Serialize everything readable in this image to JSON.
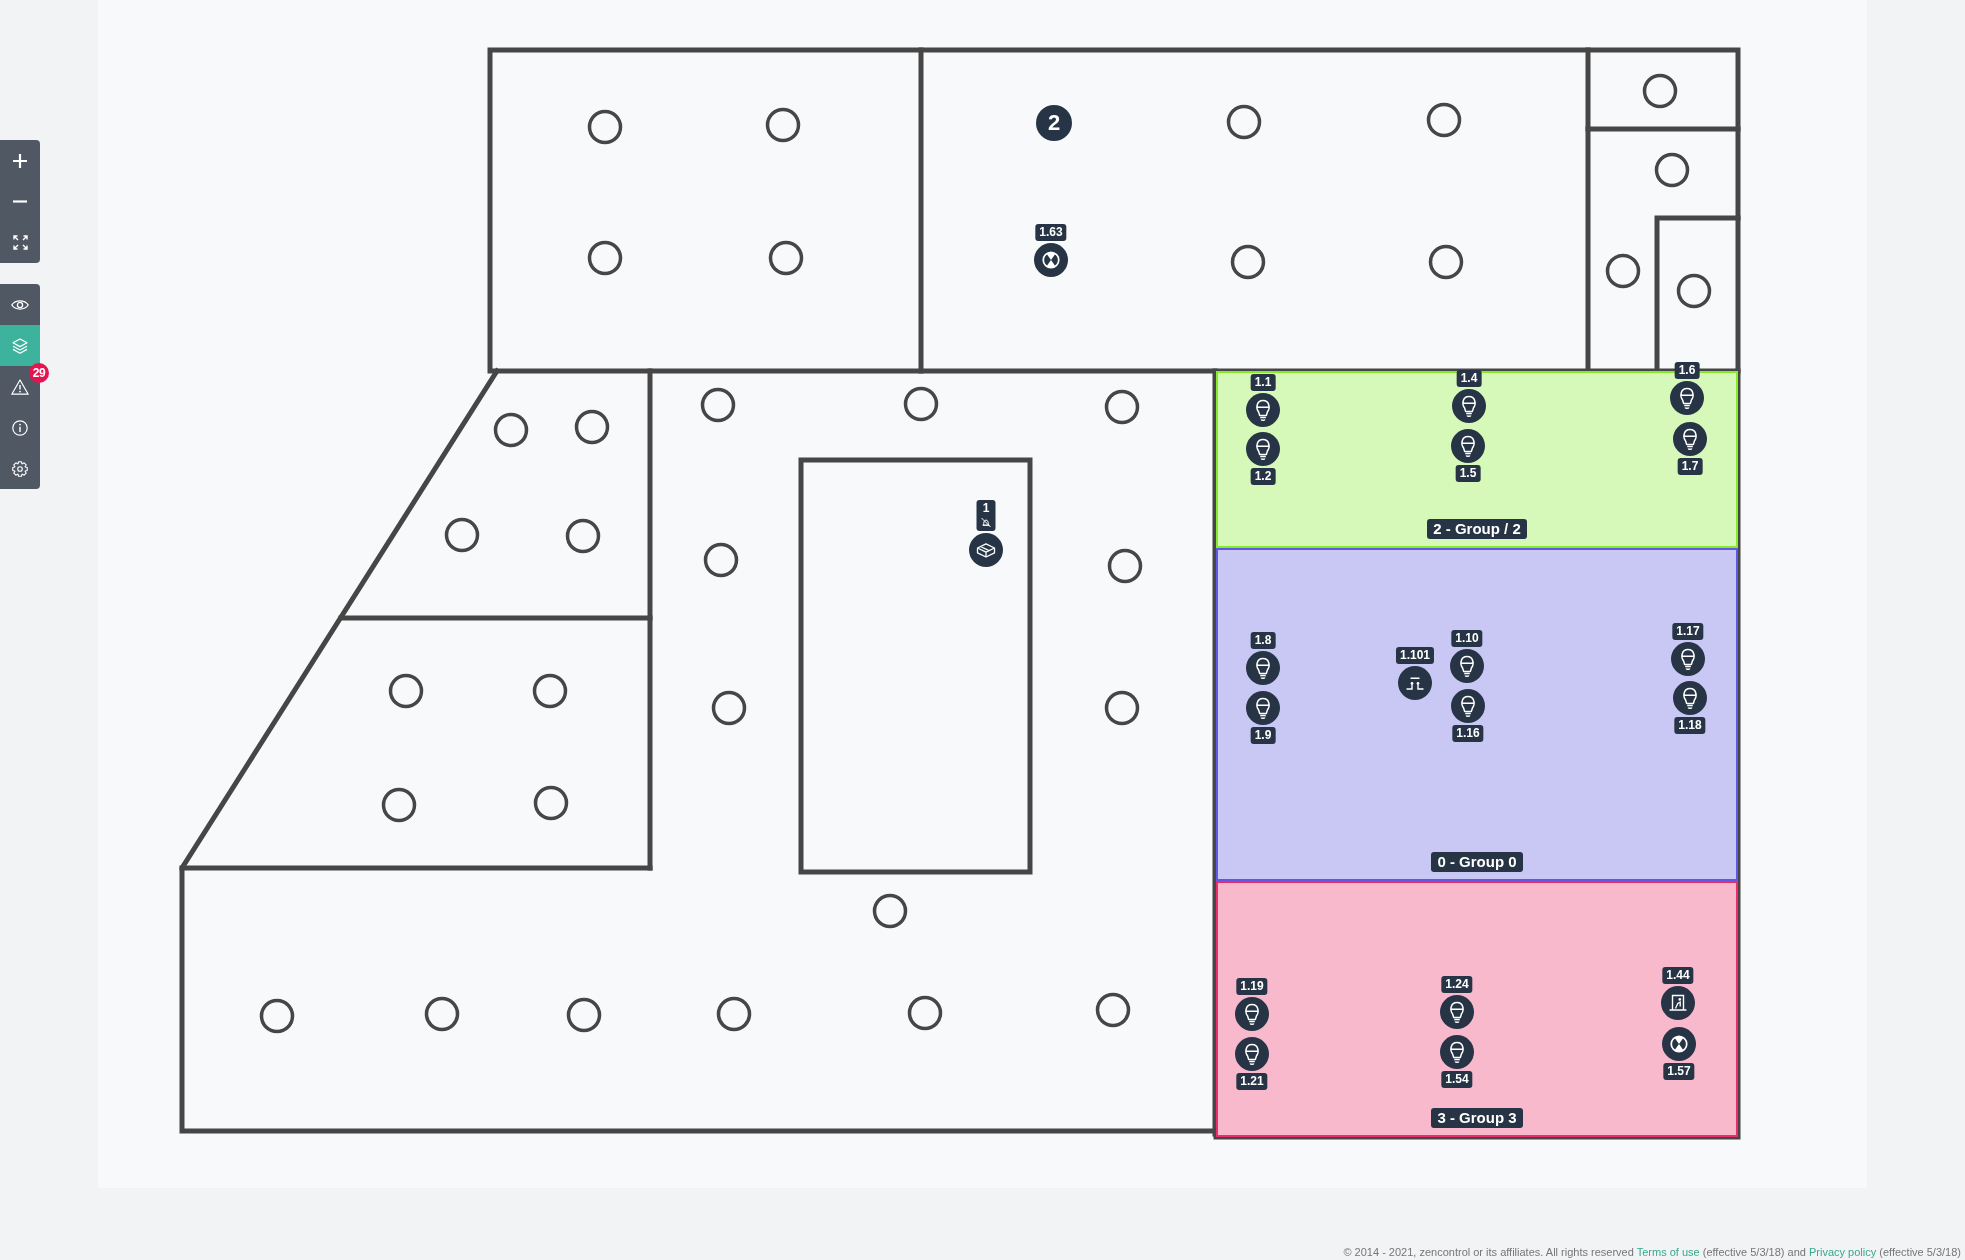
{
  "toolbar": {
    "zoom_buttons": [
      {
        "kind": "zoom-in"
      },
      {
        "kind": "zoom-out"
      },
      {
        "kind": "fit"
      }
    ],
    "view_buttons": [
      {
        "kind": "visibility",
        "selected": false
      },
      {
        "kind": "layers",
        "selected": true
      },
      {
        "kind": "warnings",
        "selected": false,
        "badge": "29"
      },
      {
        "kind": "info",
        "selected": false
      },
      {
        "kind": "settings",
        "selected": false
      }
    ]
  },
  "floor_plan": {
    "area_marker": {
      "label": "2"
    },
    "devices": [
      {
        "kind": "emergency",
        "label": "1.63"
      },
      {
        "kind": "controller",
        "label": "1",
        "offline": true
      }
    ],
    "groups": [
      {
        "label": "2 - Group / 2",
        "color": "#d6f8b8",
        "devices": [
          {
            "kind": "lamp",
            "label": "1.1"
          },
          {
            "kind": "lamp",
            "label": "1.2"
          },
          {
            "kind": "lamp",
            "label": "1.4"
          },
          {
            "kind": "lamp",
            "label": "1.5"
          },
          {
            "kind": "lamp",
            "label": "1.6"
          },
          {
            "kind": "lamp",
            "label": "1.7"
          }
        ]
      },
      {
        "label": "0 - Group 0",
        "color": "#c9c8f5",
        "devices": [
          {
            "kind": "lamp",
            "label": "1.8"
          },
          {
            "kind": "lamp",
            "label": "1.9"
          },
          {
            "kind": "switch",
            "label": "1.101"
          },
          {
            "kind": "lamp",
            "label": "1.10"
          },
          {
            "kind": "lamp",
            "label": "1.16"
          },
          {
            "kind": "lamp",
            "label": "1.17"
          },
          {
            "kind": "lamp",
            "label": "1.18"
          }
        ]
      },
      {
        "label": "3 - Group 3",
        "color": "#f8b9cd",
        "devices": [
          {
            "kind": "lamp",
            "label": "1.19"
          },
          {
            "kind": "lamp",
            "label": "1.21"
          },
          {
            "kind": "lamp",
            "label": "1.24"
          },
          {
            "kind": "lamp",
            "label": "1.54"
          },
          {
            "kind": "exit",
            "label": "1.44"
          },
          {
            "kind": "emergency",
            "label": "1.57"
          }
        ]
      }
    ]
  },
  "footer": {
    "parts": [
      {
        "kind": "text",
        "text": "© 2014 - 2021, zencontrol or its affiliates. All rights reserved"
      },
      {
        "kind": "link",
        "text": "Terms of use"
      },
      {
        "kind": "text",
        "text": "(effective 5/3/18) and"
      },
      {
        "kind": "link",
        "text": "Privacy policy"
      },
      {
        "kind": "text",
        "text": "(effective 5/3/18)"
      }
    ]
  }
}
